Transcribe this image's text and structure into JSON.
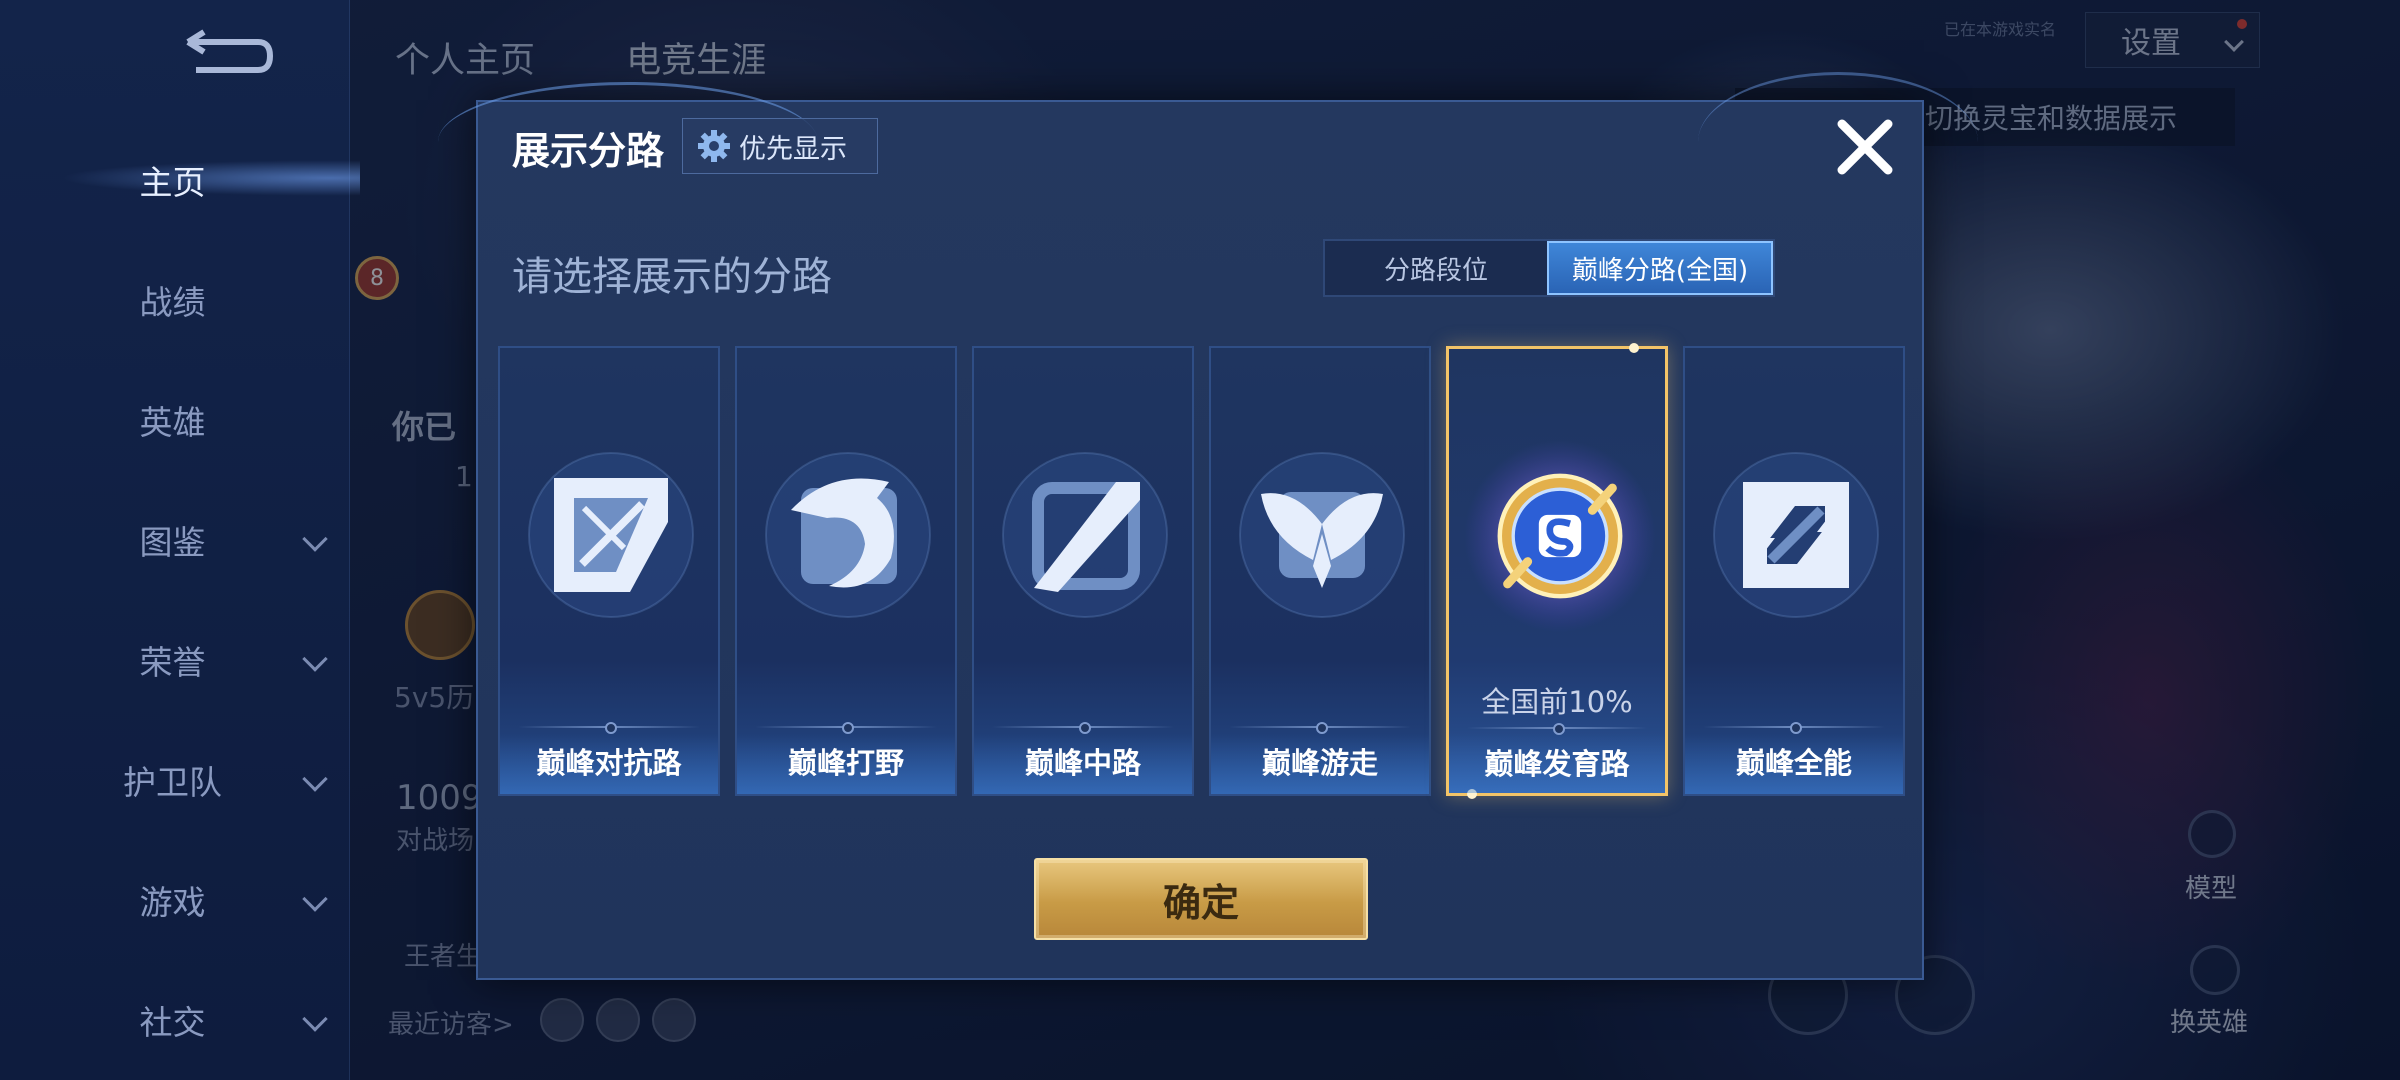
{
  "sidebar": {
    "items": [
      {
        "label": "主页",
        "active": true
      },
      {
        "label": "战绩"
      },
      {
        "label": "英雄"
      },
      {
        "label": "图鉴",
        "expandable": true
      },
      {
        "label": "荣誉",
        "expandable": true
      },
      {
        "label": "护卫队",
        "expandable": true
      },
      {
        "label": "游戏",
        "expandable": true
      },
      {
        "label": "社交",
        "expandable": true
      }
    ]
  },
  "background_page": {
    "tabs": [
      "个人主页",
      "电竞生涯"
    ],
    "settings_label": "设置",
    "realname_label": "已在本游戏实名",
    "hint_text": "切换灵宝和数据展示",
    "fragments": {
      "level_badge": "8",
      "status_text": "你已",
      "score_fragment": "1",
      "history_label": "5v5历",
      "count_value": "1009",
      "battle_label": "对战场",
      "king_label": "王者生"
    },
    "visitors_label": "最近访客>",
    "model_label": "模型",
    "swap_label": "换英雄"
  },
  "modal": {
    "title": "展示分路",
    "priority_label": "优先显示",
    "subtitle": "请选择展示的分路",
    "toggle": {
      "options": [
        "分路段位",
        "巅峰分路(全国)"
      ],
      "selected": "巅峰分路(全国)"
    },
    "cards": [
      {
        "name": "巅峰对抗路",
        "icon": "sword-slash-icon"
      },
      {
        "name": "巅峰打野",
        "icon": "dragon-icon"
      },
      {
        "name": "巅峰中路",
        "icon": "staff-icon"
      },
      {
        "name": "巅峰游走",
        "icon": "wings-icon"
      },
      {
        "name": "巅峰发育路",
        "icon": "marksman-emblem-icon",
        "rank": "全国前10%",
        "selected": true
      },
      {
        "name": "巅峰全能",
        "icon": "all-round-icon"
      }
    ],
    "confirm_label": "确定"
  },
  "colors": {
    "accent_gold": "#f3c468",
    "toggle_active": "#3f86d8",
    "modal_bg": "#24385f"
  }
}
